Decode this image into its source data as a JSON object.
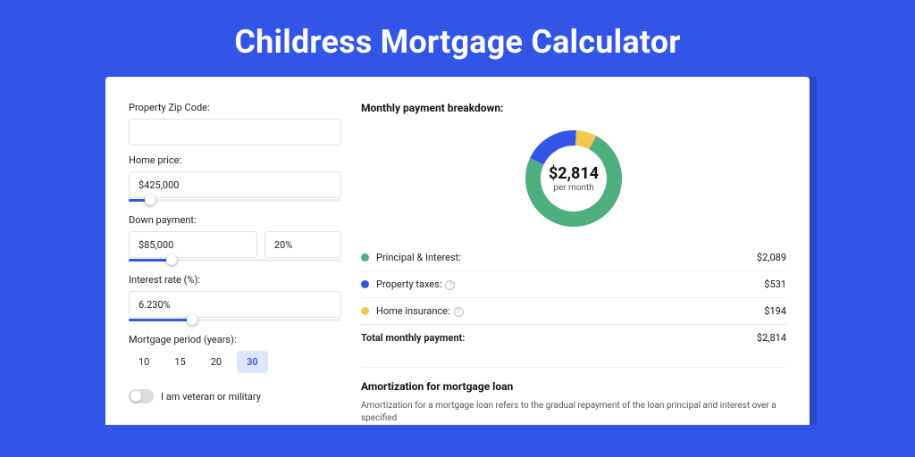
{
  "title": "Childress Mortgage Calculator",
  "form": {
    "zip_label": "Property Zip Code:",
    "zip_value": "",
    "price_label": "Home price:",
    "price_value": "$425,000",
    "price_slider_pct": 10,
    "down_label": "Down payment:",
    "down_value": "$85,000",
    "down_pct": "20%",
    "down_slider_pct": 20,
    "rate_label": "Interest rate (%):",
    "rate_value": "6.230%",
    "rate_slider_pct": 30,
    "period_label": "Mortgage period (years):",
    "periods": [
      "10",
      "15",
      "20",
      "30"
    ],
    "period_active": "30",
    "veteran_label": "I am veteran or military"
  },
  "breakdown": {
    "heading": "Monthly payment breakdown:",
    "center_amount": "$2,814",
    "center_sub": "per month",
    "rows": [
      {
        "label": "Principal & Interest:",
        "value": "$2,089",
        "color": "#4fae7f",
        "info": false,
        "share": 0.742
      },
      {
        "label": "Property taxes:",
        "value": "$531",
        "color": "#3355e7",
        "info": true,
        "share": 0.189
      },
      {
        "label": "Home insurance:",
        "value": "$194",
        "color": "#f2c94c",
        "info": true,
        "share": 0.069
      }
    ],
    "total_label": "Total monthly payment:",
    "total_value": "$2,814"
  },
  "amort": {
    "heading": "Amortization for mortgage loan",
    "body": "Amortization for a mortgage loan refers to the gradual repayment of the loan principal and interest over a specified"
  },
  "chart_data": {
    "type": "pie",
    "title": "Monthly payment breakdown",
    "series": [
      {
        "name": "Principal & Interest",
        "value": 2089,
        "color": "#4fae7f"
      },
      {
        "name": "Property taxes",
        "value": 531,
        "color": "#3355e7"
      },
      {
        "name": "Home insurance",
        "value": 194,
        "color": "#f2c94c"
      }
    ],
    "total": 2814,
    "center_label": "$2,814 per month"
  }
}
